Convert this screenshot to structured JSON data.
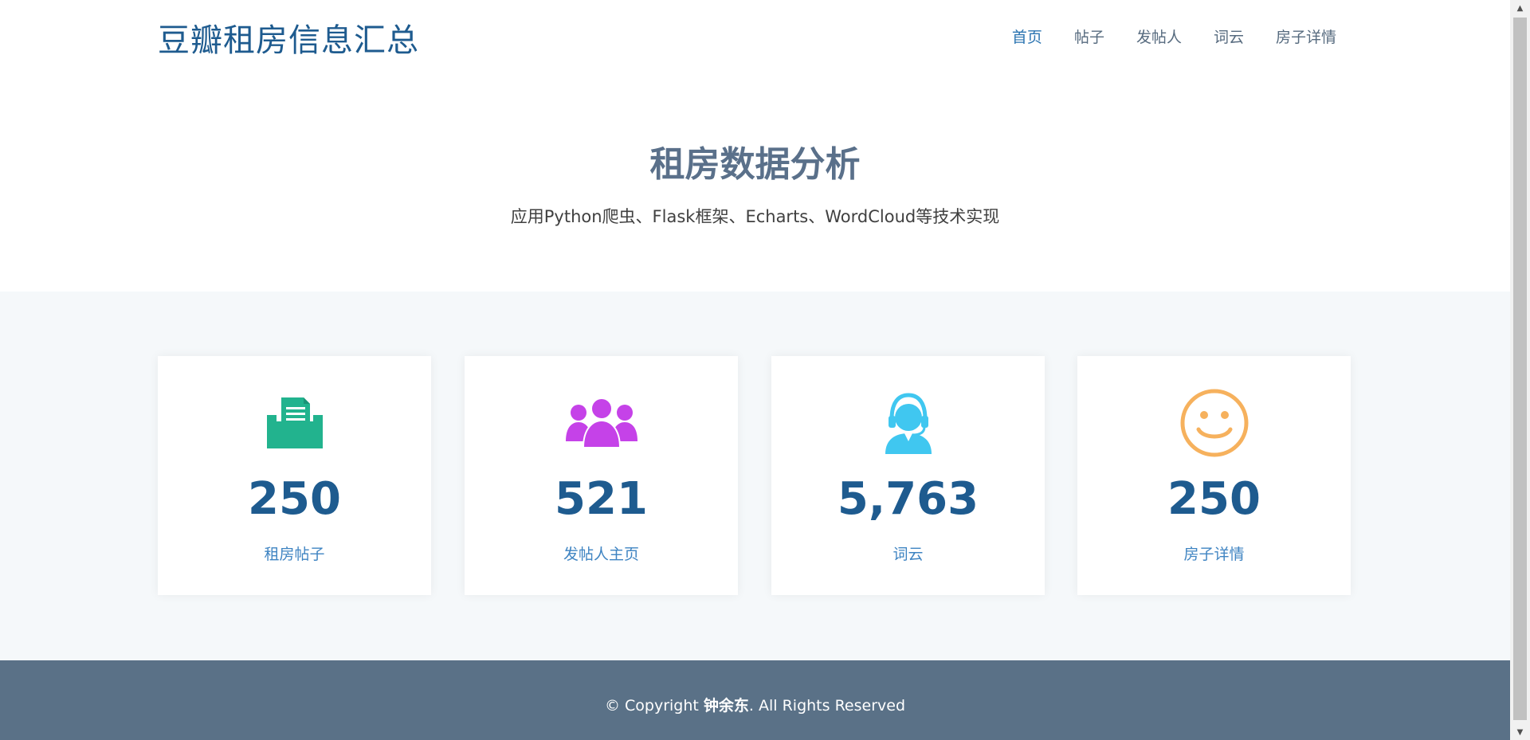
{
  "header": {
    "logo": "豆瓣租房信息汇总",
    "nav": [
      {
        "label": "首页"
      },
      {
        "label": "帖子"
      },
      {
        "label": "发帖人"
      },
      {
        "label": "词云"
      },
      {
        "label": "房子详情"
      }
    ]
  },
  "hero": {
    "title": "租房数据分析",
    "subtitle": "应用Python爬虫、Flask框架、Echarts、WordCloud等技术实现"
  },
  "cards": [
    {
      "icon": "folder-document-icon",
      "count": "250",
      "label": "租房帖子",
      "color": "#22b38e"
    },
    {
      "icon": "people-group-icon",
      "count": "521",
      "label": "发帖人主页",
      "color": "#c542e8"
    },
    {
      "icon": "headset-agent-icon",
      "count": "5,763",
      "label": "词云",
      "color": "#40c7f0"
    },
    {
      "icon": "smiley-face-icon",
      "count": "250",
      "label": "房子详情",
      "color": "#f6b15d"
    }
  ],
  "footer": {
    "prefix": "© Copyright ",
    "author": "钟余东",
    "suffix": ". All Rights Reserved"
  },
  "colors": {
    "brand": "#1e5b8f",
    "nav_active": "#2b74b1",
    "footer_bg": "#5a7187",
    "stats_bg": "#f5f8fa"
  }
}
